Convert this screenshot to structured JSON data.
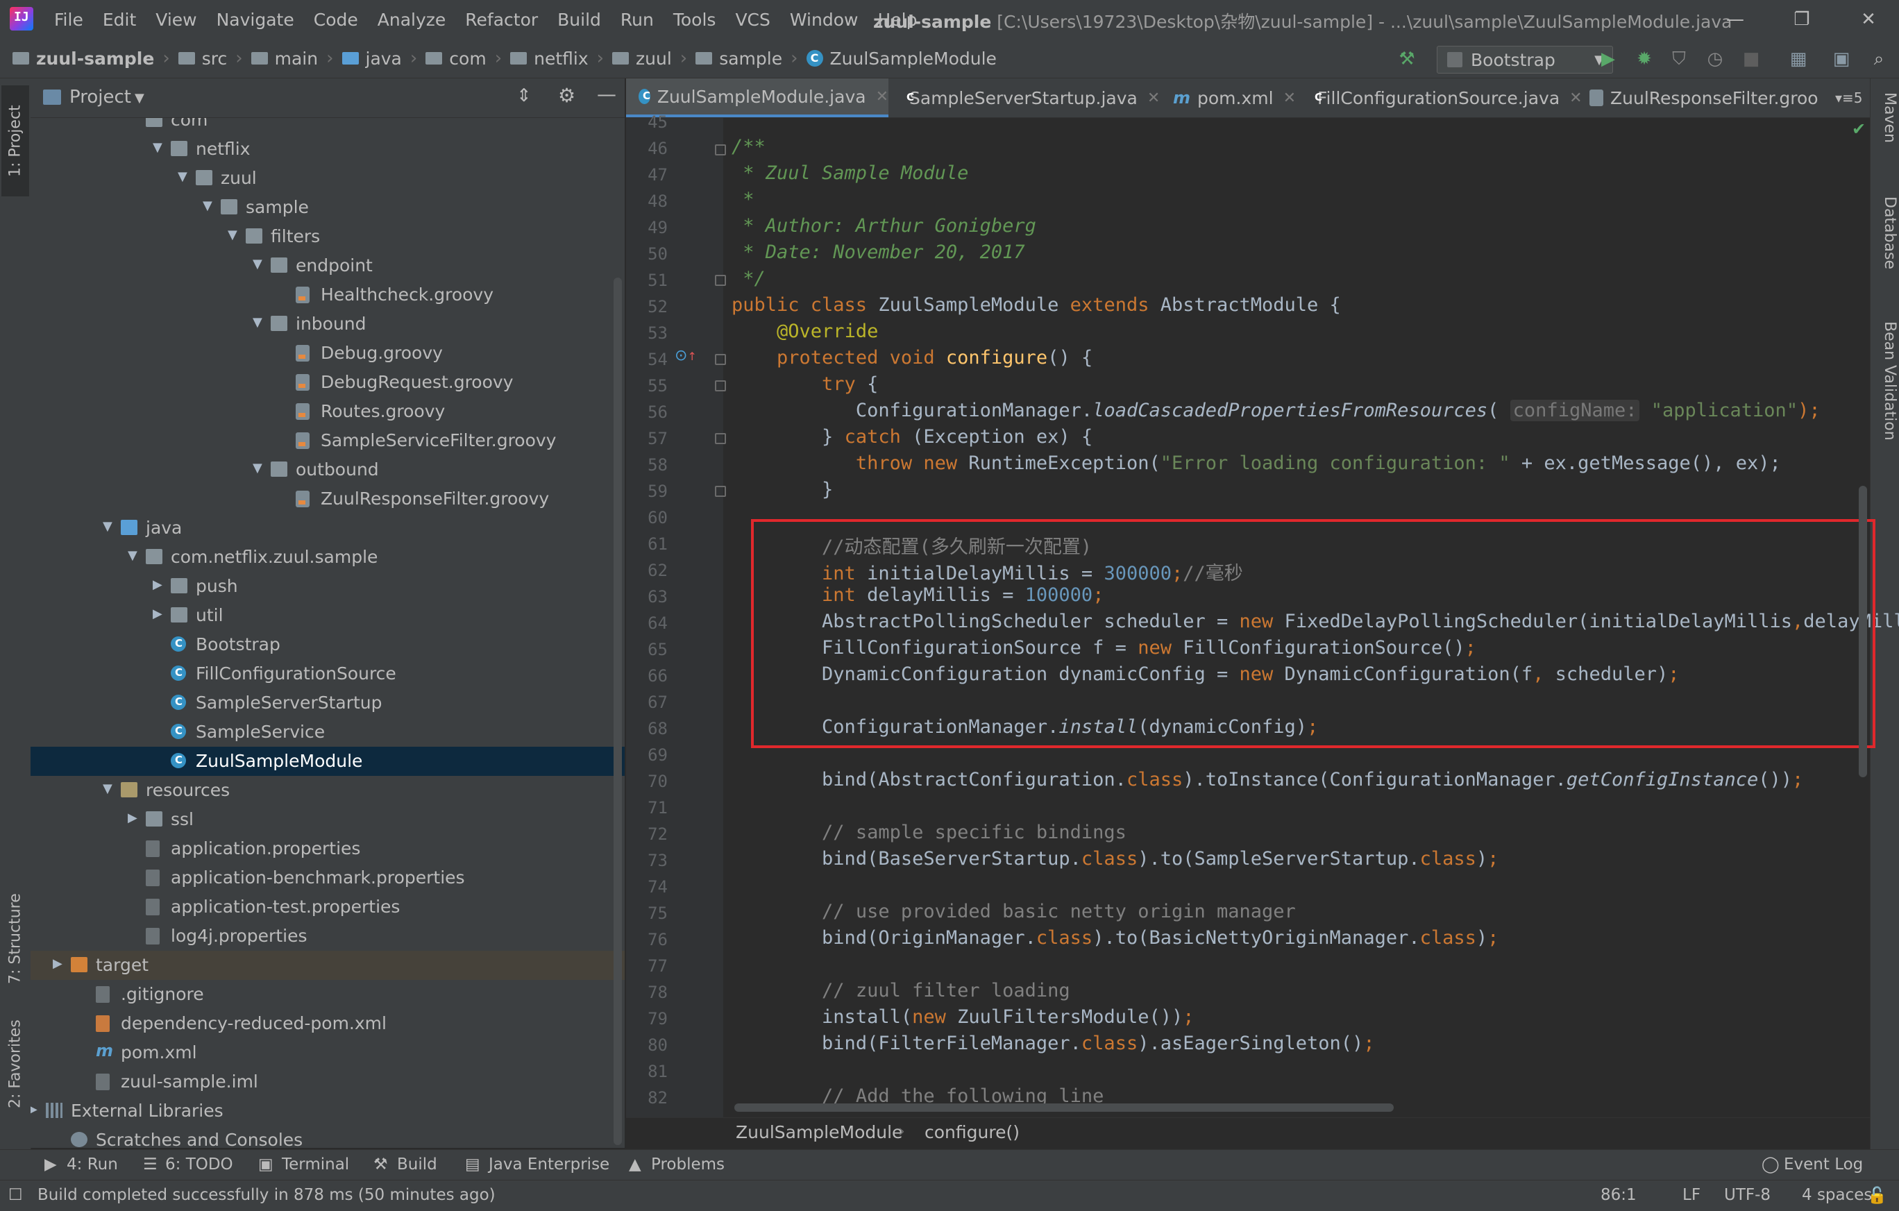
{
  "menubar": {
    "items": [
      "File",
      "Edit",
      "View",
      "Navigate",
      "Code",
      "Analyze",
      "Refactor",
      "Build",
      "Run",
      "Tools",
      "VCS",
      "Window",
      "Help"
    ],
    "project": "zuul-sample",
    "title_path": " [C:\\Users\\19723\\Desktop\\杂物\\zuul-sample] - ...\\zuul\\sample\\ZuulSampleModule.java"
  },
  "navbar": {
    "crumbs": [
      "zuul-sample",
      "src",
      "main",
      "java",
      "com",
      "netflix",
      "zuul",
      "sample",
      "ZuulSampleModule"
    ],
    "run_config": "Bootstrap"
  },
  "left_tools": [
    "1: Project",
    "7: Structure",
    "2: Favorites"
  ],
  "right_tools": [
    "Maven",
    "Database",
    "Bean Validation"
  ],
  "project_panel": {
    "title": "Project",
    "tree": [
      {
        "label": "com",
        "kind": "folder",
        "arrow": ""
      },
      {
        "label": "netflix",
        "kind": "folder",
        "arrow": "▼"
      },
      {
        "label": "zuul",
        "kind": "folder",
        "arrow": "▼"
      },
      {
        "label": "sample",
        "kind": "folder",
        "arrow": "▼"
      },
      {
        "label": "filters",
        "kind": "folder",
        "arrow": "▼"
      },
      {
        "label": "endpoint",
        "kind": "folder",
        "arrow": "▼"
      },
      {
        "label": "Healthcheck.groovy",
        "kind": "groovy",
        "arrow": ""
      },
      {
        "label": "inbound",
        "kind": "folder",
        "arrow": "▼"
      },
      {
        "label": "Debug.groovy",
        "kind": "groovy",
        "arrow": ""
      },
      {
        "label": "DebugRequest.groovy",
        "kind": "groovy",
        "arrow": ""
      },
      {
        "label": "Routes.groovy",
        "kind": "groovy",
        "arrow": ""
      },
      {
        "label": "SampleServiceFilter.groovy",
        "kind": "groovy",
        "arrow": ""
      },
      {
        "label": "outbound",
        "kind": "folder",
        "arrow": "▼"
      },
      {
        "label": "ZuulResponseFilter.groovy",
        "kind": "groovy",
        "arrow": ""
      },
      {
        "label": "java",
        "kind": "src",
        "arrow": "▼"
      },
      {
        "label": "com.netflix.zuul.sample",
        "kind": "folder",
        "arrow": "▼"
      },
      {
        "label": "push",
        "kind": "folder",
        "arrow": "▶"
      },
      {
        "label": "util",
        "kind": "folder",
        "arrow": "▶"
      },
      {
        "label": "Bootstrap",
        "kind": "class",
        "arrow": ""
      },
      {
        "label": "FillConfigurationSource",
        "kind": "class",
        "arrow": ""
      },
      {
        "label": "SampleServerStartup",
        "kind": "class",
        "arrow": ""
      },
      {
        "label": "SampleService",
        "kind": "class",
        "arrow": ""
      },
      {
        "label": "ZuulSampleModule",
        "kind": "class",
        "arrow": "",
        "selected": true
      },
      {
        "label": "resources",
        "kind": "res",
        "arrow": "▼"
      },
      {
        "label": "ssl",
        "kind": "folder",
        "arrow": "▶"
      },
      {
        "label": "application.properties",
        "kind": "prop",
        "arrow": ""
      },
      {
        "label": "application-benchmark.properties",
        "kind": "prop",
        "arrow": ""
      },
      {
        "label": "application-test.properties",
        "kind": "prop",
        "arrow": ""
      },
      {
        "label": "log4j.properties",
        "kind": "prop",
        "arrow": ""
      },
      {
        "label": "target",
        "kind": "target",
        "arrow": "▶"
      },
      {
        "label": ".gitignore",
        "kind": "prop",
        "arrow": ""
      },
      {
        "label": "dependency-reduced-pom.xml",
        "kind": "xml",
        "arrow": ""
      },
      {
        "label": "pom.xml",
        "kind": "mvn",
        "arrow": ""
      },
      {
        "label": "zuul-sample.iml",
        "kind": "prop",
        "arrow": ""
      },
      {
        "label": "External Libraries",
        "kind": "libs",
        "arrow": "▶"
      },
      {
        "label": "Scratches and Consoles",
        "kind": "scratch",
        "arrow": ""
      }
    ]
  },
  "tabs": [
    {
      "label": "ZuulSampleModule.java",
      "icon": "class",
      "active": true
    },
    {
      "label": "SampleServerStartup.java",
      "icon": "class"
    },
    {
      "label": "pom.xml",
      "icon": "maven"
    },
    {
      "label": "FillConfigurationSource.java",
      "icon": "class"
    },
    {
      "label": "ZuulResponseFilter.groo",
      "icon": "groovy"
    }
  ],
  "tabs_overflow": "5",
  "editor": {
    "line_numbers": [
      "45",
      "46",
      "47",
      "48",
      "49",
      "50",
      "51",
      "52",
      "53",
      "54",
      "55",
      "56",
      "57",
      "58",
      "59",
      "60",
      "61",
      "62",
      "63",
      "64",
      "65",
      "66",
      "67",
      "68",
      "69",
      "70",
      "71",
      "72",
      "73",
      "74",
      "75",
      "76",
      "77",
      "78",
      "79",
      "80",
      "81",
      "82"
    ],
    "code": {
      "l46": "/**",
      "l47": " * Zuul Sample Module",
      "l48": " *",
      "l49": " * Author: Arthur Gonigberg",
      "l50": " * Date: November 20, 2017",
      "l51": " */",
      "l52_kw1": "public class ",
      "l52_a": "ZuulSampleModule ",
      "l52_kw2": "extends ",
      "l52_b": "AbstractModule {",
      "l53": "@Override",
      "l54_kw": "protected void ",
      "l54_fn": "configure",
      "l54_b": "() {",
      "l55": "try ",
      "l55_b": "{",
      "l56_a": "ConfigurationManager.",
      "l56_it": "loadCascadedPropertiesFromResources",
      "l56_b": "(",
      "l56_hint": "configName:",
      "l56_st": "\"application\"",
      "l56_c": ");",
      "l57_a": "} ",
      "l57_kw": "catch ",
      "l57_b": "(Exception ex) {",
      "l58_kw": "throw new ",
      "l58_a": "RuntimeException(",
      "l58_st": "\"Error loading configuration: \"",
      "l58_b": " + ex.getMessage(), ex);",
      "l59": "}",
      "l61": "//动态配置(多久刷新一次配置)",
      "l62_kw": "int ",
      "l62_a": "initialDelayMillis = ",
      "l62_nm": "300000",
      "l62_kw2": ";",
      "l62_cm": "//毫秒",
      "l63_kw": "int ",
      "l63_a": "delayMillis = ",
      "l63_nm": "100000",
      "l63_kw2": ";",
      "l64_a": "AbstractPollingScheduler scheduler = ",
      "l64_kw": "new ",
      "l64_b": "FixedDelayPollingScheduler(initialDelayMillis",
      "l64_kw2": ",",
      "l64_c": "delayMillis",
      "l65_a": "FillConfigurationSource f = ",
      "l65_kw": "new ",
      "l65_b": "FillConfigurationSource()",
      "l65_kw2": ";",
      "l66_a": "DynamicConfiguration dynamicConfig = ",
      "l66_kw": "new ",
      "l66_b": "DynamicConfiguration(f",
      "l66_kw2": ", ",
      "l66_c": "scheduler)",
      "l66_kw3": ";",
      "l68_a": "ConfigurationManager.",
      "l68_it": "install",
      "l68_b": "(dynamicConfig)",
      "l68_kw": ";",
      "l70_a": "bind(AbstractConfiguration.",
      "l70_kw": "class",
      "l70_b": ").toInstance(ConfigurationManager.",
      "l70_it": "getConfigInstance",
      "l70_c": "())",
      "l70_kw2": ";",
      "l72": "// sample specific bindings",
      "l73_a": "bind(BaseServerStartup.",
      "l73_kw": "class",
      "l73_b": ").to(SampleServerStartup.",
      "l73_kw2": "class",
      "l73_c": ")",
      "l73_kw3": ";",
      "l75": "// use provided basic netty origin manager",
      "l76_a": "bind(OriginManager.",
      "l76_kw": "class",
      "l76_b": ").to(BasicNettyOriginManager.",
      "l76_kw2": "class",
      "l76_c": ")",
      "l76_kw3": ";",
      "l78": "// zuul filter loading",
      "l79_a": "install(",
      "l79_kw": "new ",
      "l79_b": "ZuulFiltersModule())",
      "l79_kw2": ";",
      "l80_a": "bind(FilterFileManager.",
      "l80_kw": "class",
      "l80_b": ").asEagerSingleton()",
      "l80_kw2": ";",
      "l82": "// Add the following line"
    }
  },
  "editor_breadcrumb": [
    "ZuulSampleModule",
    "configure()"
  ],
  "bottom_tools": [
    "4: Run",
    "6: TODO",
    "Terminal",
    "Build",
    "Java Enterprise",
    "Problems"
  ],
  "event_log": "Event Log",
  "status": {
    "message": "Build completed successfully in 878 ms (50 minutes ago)",
    "position": "86:1",
    "line_sep": "LF",
    "encoding": "UTF-8",
    "indent": "4 spaces"
  },
  "colors": {
    "keyword": "#cc7832",
    "string": "#6a8759",
    "number": "#6897bb",
    "comment": "#808080",
    "doc": "#629755",
    "highlight_box": "#e0282c",
    "selection": "#0d293e"
  }
}
